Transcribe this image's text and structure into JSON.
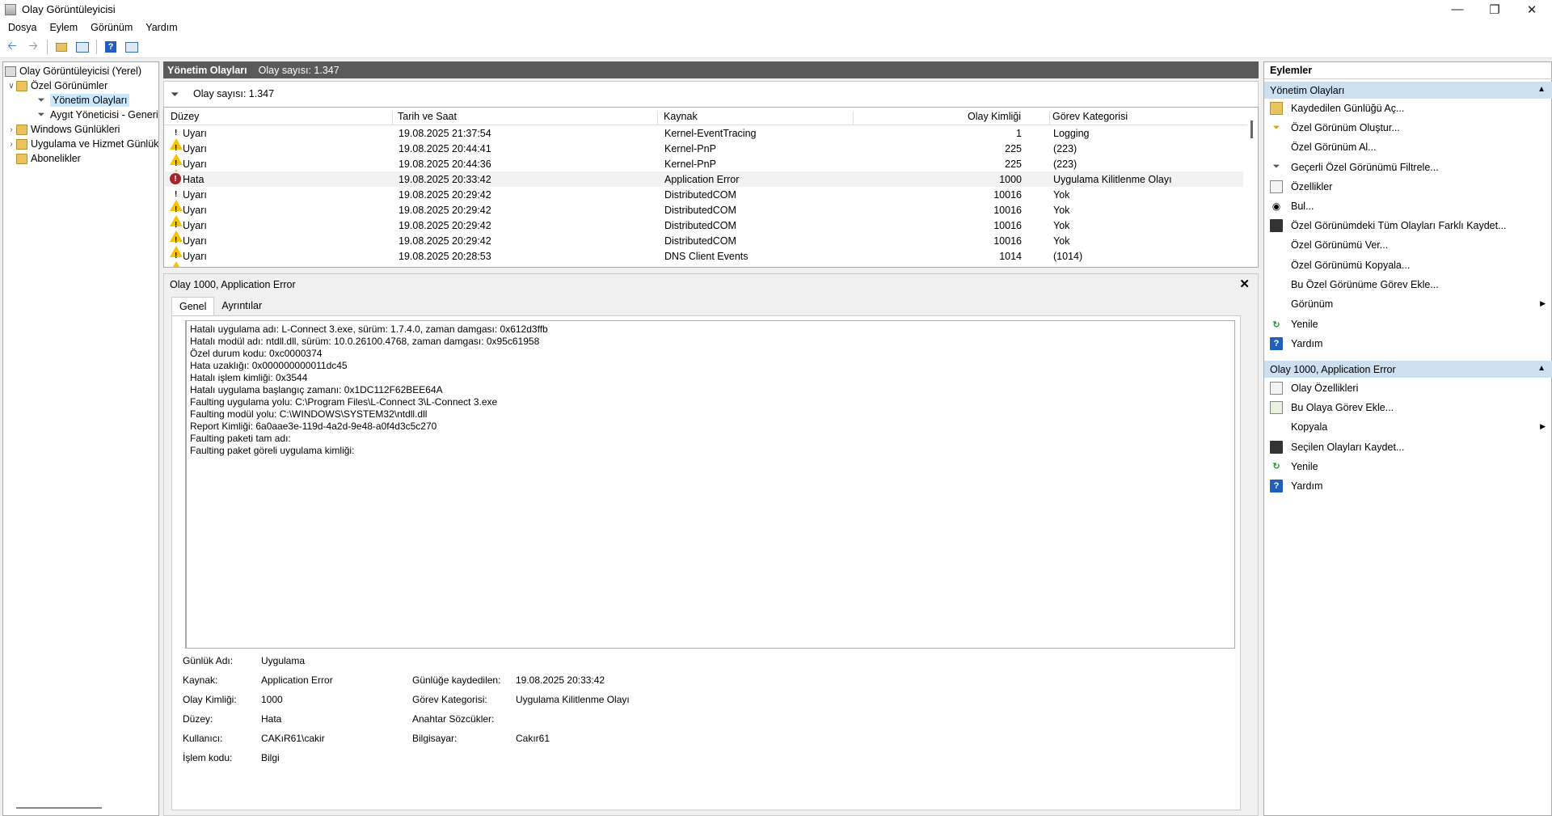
{
  "window": {
    "title": "Olay Görüntüleyicisi"
  },
  "menu": [
    "Dosya",
    "Eylem",
    "Görünüm",
    "Yardım"
  ],
  "tree": [
    {
      "label": "Olay Görüntüleyicisi (Yerel)"
    },
    {
      "label": "Özel Görünümler"
    },
    {
      "label": "Yönetim Olayları"
    },
    {
      "label": "Aygıt Yöneticisi - Generic"
    },
    {
      "label": "Windows Günlükleri"
    },
    {
      "label": "Uygulama ve Hizmet Günlük"
    },
    {
      "label": "Abonelikler"
    }
  ],
  "center": {
    "header_title": "Yönetim Olayları",
    "header_count": "Olay sayısı: 1.347",
    "filter_text": "Olay sayısı: 1.347",
    "columns": [
      "Düzey",
      "Tarih ve Saat",
      "Kaynak",
      "Olay Kimliği",
      "Görev Kategorisi"
    ],
    "rows": [
      {
        "level": "Uyarı",
        "icon": "warning-icon",
        "date": "19.08.2025 21:37:54",
        "source": "Kernel-EventTracing",
        "id": "1",
        "category": "Logging"
      },
      {
        "level": "Uyarı",
        "icon": "warning-icon",
        "date": "19.08.2025 20:44:41",
        "source": "Kernel-PnP",
        "id": "225",
        "category": "(223)"
      },
      {
        "level": "Uyarı",
        "icon": "warning-icon",
        "date": "19.08.2025 20:44:36",
        "source": "Kernel-PnP",
        "id": "225",
        "category": "(223)"
      },
      {
        "level": "Hata",
        "icon": "error-icon",
        "date": "19.08.2025 20:33:42",
        "source": "Application Error",
        "id": "1000",
        "category": "Uygulama Kilitlenme Olayı"
      },
      {
        "level": "Uyarı",
        "icon": "warning-icon",
        "date": "19.08.2025 20:29:42",
        "source": "DistributedCOM",
        "id": "10016",
        "category": "Yok"
      },
      {
        "level": "Uyarı",
        "icon": "warning-icon",
        "date": "19.08.2025 20:29:42",
        "source": "DistributedCOM",
        "id": "10016",
        "category": "Yok"
      },
      {
        "level": "Uyarı",
        "icon": "warning-icon",
        "date": "19.08.2025 20:29:42",
        "source": "DistributedCOM",
        "id": "10016",
        "category": "Yok"
      },
      {
        "level": "Uyarı",
        "icon": "warning-icon",
        "date": "19.08.2025 20:29:42",
        "source": "DistributedCOM",
        "id": "10016",
        "category": "Yok"
      },
      {
        "level": "Uyarı",
        "icon": "warning-icon",
        "date": "19.08.2025 20:28:53",
        "source": "DNS Client Events",
        "id": "1014",
        "category": "(1014)"
      }
    ]
  },
  "detail": {
    "title": "Olay 1000, Application Error",
    "tabs": [
      "Genel",
      "Ayrıntılar"
    ],
    "description": [
      "Hatalı uygulama adı: L-Connect 3.exe, sürüm: 1.7.4.0, zaman damgası: 0x612d3ffb",
      "Hatalı modül adı: ntdll.dll, sürüm: 10.0.26100.4768, zaman damgası: 0x95c61958",
      "Özel durum kodu: 0xc0000374",
      "Hata uzaklığı: 0x000000000011dc45",
      "Hatalı işlem kimliği: 0x3544",
      "Hatalı uygulama başlangıç zamanı: 0x1DC112F62BEE64A",
      "Faulting uygulama yolu: C:\\Program Files\\L-Connect 3\\L-Connect 3.exe",
      "Faulting modül yolu: C:\\WINDOWS\\SYSTEM32\\ntdll.dll",
      "Report Kimliği: 6a0aae3e-119d-4a2d-9e48-a0f4d3c5c270",
      "Faulting paketi tam adı:",
      "Faulting paket göreli uygulama kimliği:"
    ],
    "props": {
      "log_name_label": "Günlük Adı:",
      "log_name": "Uygulama",
      "source_label": "Kaynak:",
      "source": "Application Error",
      "logged_label": "Günlüğe kaydedilen:",
      "logged": "19.08.2025 20:33:42",
      "event_id_label": "Olay Kimliği:",
      "event_id": "1000",
      "task_label": "Görev Kategorisi:",
      "task": "Uygulama Kilitlenme Olayı",
      "level_label": "Düzey:",
      "level": "Hata",
      "keywords_label": "Anahtar Sözcükler:",
      "keywords": "",
      "user_label": "Kullanıcı:",
      "user": "CAKıR61\\cakir",
      "computer_label": "Bilgisayar:",
      "computer": "Cakır61",
      "opcode_label": "İşlem kodu:",
      "opcode": "Bilgi"
    }
  },
  "actions": {
    "header": "Eylemler",
    "section1": "Yönetim Olayları",
    "items1": [
      {
        "label": "Kaydedilen Günlüğü Aç...",
        "icon": "open-log-icon"
      },
      {
        "label": "Özel Görünüm Oluştur...",
        "icon": "create-view-icon"
      },
      {
        "label": "Özel Görünüm Al...",
        "icon": ""
      },
      {
        "label": "Geçerli Özel Görünümü Filtrele...",
        "icon": "filter-icon"
      },
      {
        "label": "Özellikler",
        "icon": "properties-icon"
      },
      {
        "label": "Bul...",
        "icon": "find-icon"
      },
      {
        "label": "Özel Görünümdeki Tüm Olayları Farklı Kaydet...",
        "icon": "save-icon"
      },
      {
        "label": "Özel Görünümü Ver...",
        "icon": ""
      },
      {
        "label": "Özel Görünümü Kopyala...",
        "icon": ""
      },
      {
        "label": "Bu Özel Görünüme Görev Ekle...",
        "icon": ""
      },
      {
        "label": "Görünüm",
        "icon": ""
      },
      {
        "label": "Yenile",
        "icon": "refresh-icon"
      },
      {
        "label": "Yardım",
        "icon": "help-icon"
      }
    ],
    "section2": "Olay 1000, Application Error",
    "items2": [
      {
        "label": "Olay Özellikleri",
        "icon": "properties-icon"
      },
      {
        "label": "Bu Olaya Görev Ekle...",
        "icon": "task-icon"
      },
      {
        "label": "Kopyala",
        "icon": ""
      },
      {
        "label": "Seçilen Olayları Kaydet...",
        "icon": "save-icon"
      },
      {
        "label": "Yenile",
        "icon": "refresh-icon"
      },
      {
        "label": "Yardım",
        "icon": "help-icon"
      }
    ]
  }
}
